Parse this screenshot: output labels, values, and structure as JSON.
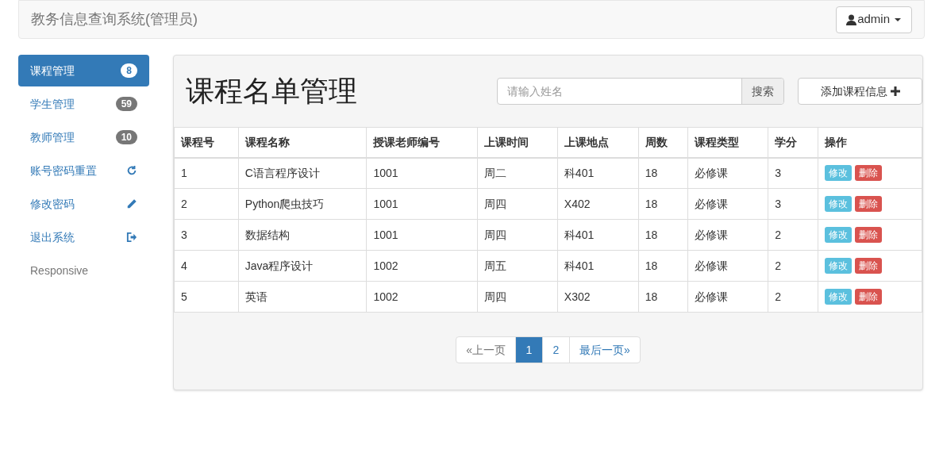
{
  "navbar": {
    "brand": "教务信息查询系统(管理员)",
    "user_menu": "admin"
  },
  "sidebar": {
    "items": [
      {
        "label": "课程管理",
        "kind": "badge",
        "badge": "8",
        "selected": true
      },
      {
        "label": "学生管理",
        "kind": "badge",
        "badge": "59",
        "selected": false
      },
      {
        "label": "教师管理",
        "kind": "badge",
        "badge": "10",
        "selected": false
      },
      {
        "label": "账号密码重置",
        "kind": "refresh",
        "selected": false
      },
      {
        "label": "修改密码",
        "kind": "pencil",
        "selected": false
      },
      {
        "label": "退出系统",
        "kind": "logout",
        "selected": false
      },
      {
        "label": "Responsive",
        "kind": "plain",
        "selected": false
      }
    ]
  },
  "panel": {
    "title": "课程名单管理",
    "search": {
      "placeholder": "请输入姓名",
      "button": "搜索"
    },
    "add_button": "添加课程信息",
    "table": {
      "columns": [
        "课程号",
        "课程名称",
        "授课老师编号",
        "上课时间",
        "上课地点",
        "周数",
        "课程类型",
        "学分",
        "操作"
      ],
      "rows": [
        {
          "cells": [
            "1",
            "C语言程序设计",
            "1001",
            "周二",
            "科401",
            "18",
            "必修课",
            "3"
          ],
          "actions": [
            "修改",
            "删除"
          ]
        },
        {
          "cells": [
            "2",
            "Python爬虫技巧",
            "1001",
            "周四",
            "X402",
            "18",
            "必修课",
            "3"
          ],
          "actions": [
            "修改",
            "删除"
          ]
        },
        {
          "cells": [
            "3",
            "数据结构",
            "1001",
            "周四",
            "科401",
            "18",
            "必修课",
            "2"
          ],
          "actions": [
            "修改",
            "删除"
          ]
        },
        {
          "cells": [
            "4",
            "Java程序设计",
            "1002",
            "周五",
            "科401",
            "18",
            "必修课",
            "2"
          ],
          "actions": [
            "修改",
            "删除"
          ]
        },
        {
          "cells": [
            "5",
            "英语",
            "1002",
            "周四",
            "X302",
            "18",
            "必修课",
            "2"
          ],
          "actions": [
            "修改",
            "删除"
          ]
        }
      ]
    },
    "pagination": {
      "prev": {
        "label": "«上一页",
        "disabled": true
      },
      "pages": [
        {
          "label": "1",
          "selected": true
        },
        {
          "label": "2",
          "selected": false
        }
      ],
      "next": {
        "label": "最后一页»",
        "disabled": false
      }
    }
  }
}
